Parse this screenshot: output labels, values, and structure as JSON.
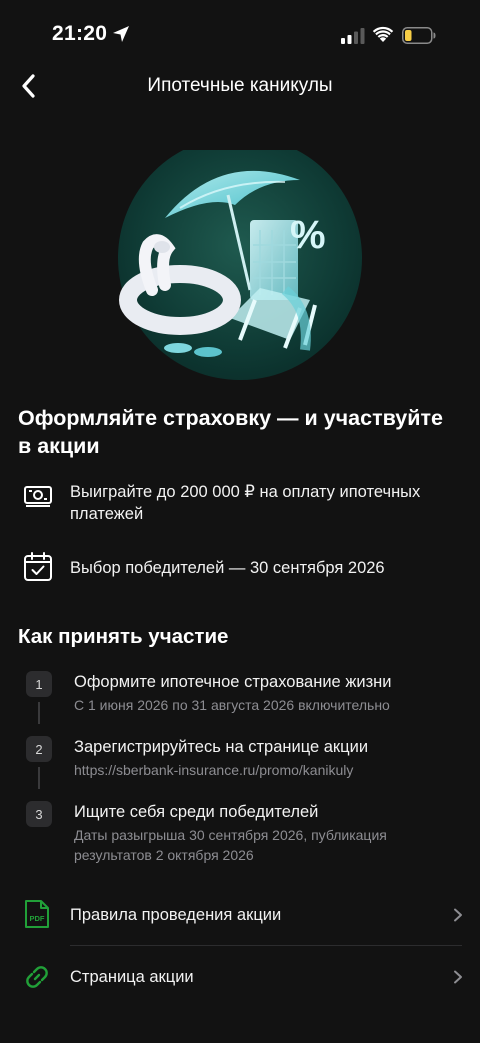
{
  "status_bar": {
    "time": "21:20"
  },
  "nav": {
    "title": "Ипотечные каникулы"
  },
  "headline": "Оформляйте страховку — и участвуйте в акции",
  "benefits": [
    {
      "icon": "banknote-icon",
      "text": "Выиграйте до 200 000 ₽ на оплату ипотечных платежей"
    },
    {
      "icon": "calendar-check-icon",
      "text": "Выбор победителей — 30 сентября 2026"
    }
  ],
  "how_to": {
    "title": "Как принять участие",
    "steps": [
      {
        "number": "1",
        "title": "Оформите ипотечное страхование жизни",
        "subtitle": "С 1 июня 2026 по 31 августа 2026 включительно"
      },
      {
        "number": "2",
        "title": "Зарегистрируйтесь на странице акции",
        "subtitle": "https://sberbank-insurance.ru/promo/kanikuly"
      },
      {
        "number": "3",
        "title": "Ищите себя среди победителей",
        "subtitle": "Даты разыгрыша 30 сентября 2026, публикация результатов 2 октября 2026"
      }
    ]
  },
  "links": [
    {
      "icon": "pdf-icon",
      "icon_text": "PDF",
      "label": "Правила проведения акции"
    },
    {
      "icon": "link-icon",
      "label": "Страница акции"
    }
  ],
  "colors": {
    "background": "#121212",
    "accent_green": "#21a038",
    "muted_text": "#8d8d92"
  }
}
